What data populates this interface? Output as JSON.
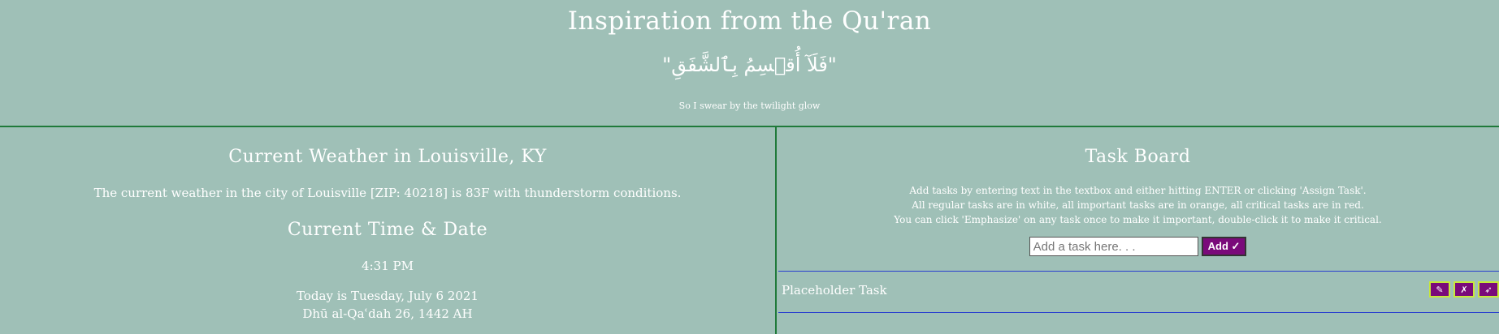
{
  "header": {
    "title": "Inspiration from the Qu'ran",
    "arabic": "\"فَلَآ أُقۡسِمُ بِٱلشَّفَقِ\"",
    "translation": "So I swear by the twilight glow"
  },
  "weather": {
    "title": "Current Weather in Louisville, KY",
    "text": "The current weather in the city of Louisville [ZIP: 40218] is 83F with thunderstorm conditions."
  },
  "time": {
    "title": "Current Time & Date",
    "time": "4:31 PM",
    "date_line": "Today is Tuesday, July 6 2021",
    "hijri_line": "Dhū al-Qaʿdah 26, 1442 AH"
  },
  "tasks": {
    "title": "Task Board",
    "instructions": [
      "Add tasks by entering text in the textbox and either hitting ENTER or clicking 'Assign Task'.",
      "All regular tasks are in white, all important tasks are in orange, all critical tasks are in red.",
      "You can click 'Emphasize' on any task once to make it important, double-click it to make it critical."
    ],
    "input_placeholder": "Add a task here. . .",
    "add_label": "Add ✓",
    "items": [
      {
        "label": "Placeholder Task",
        "actions": [
          {
            "name": "edit-icon",
            "glyph": "✎"
          },
          {
            "name": "delete-icon",
            "glyph": "✗"
          },
          {
            "name": "emphasize-icon",
            "glyph": "➶"
          }
        ]
      }
    ]
  }
}
